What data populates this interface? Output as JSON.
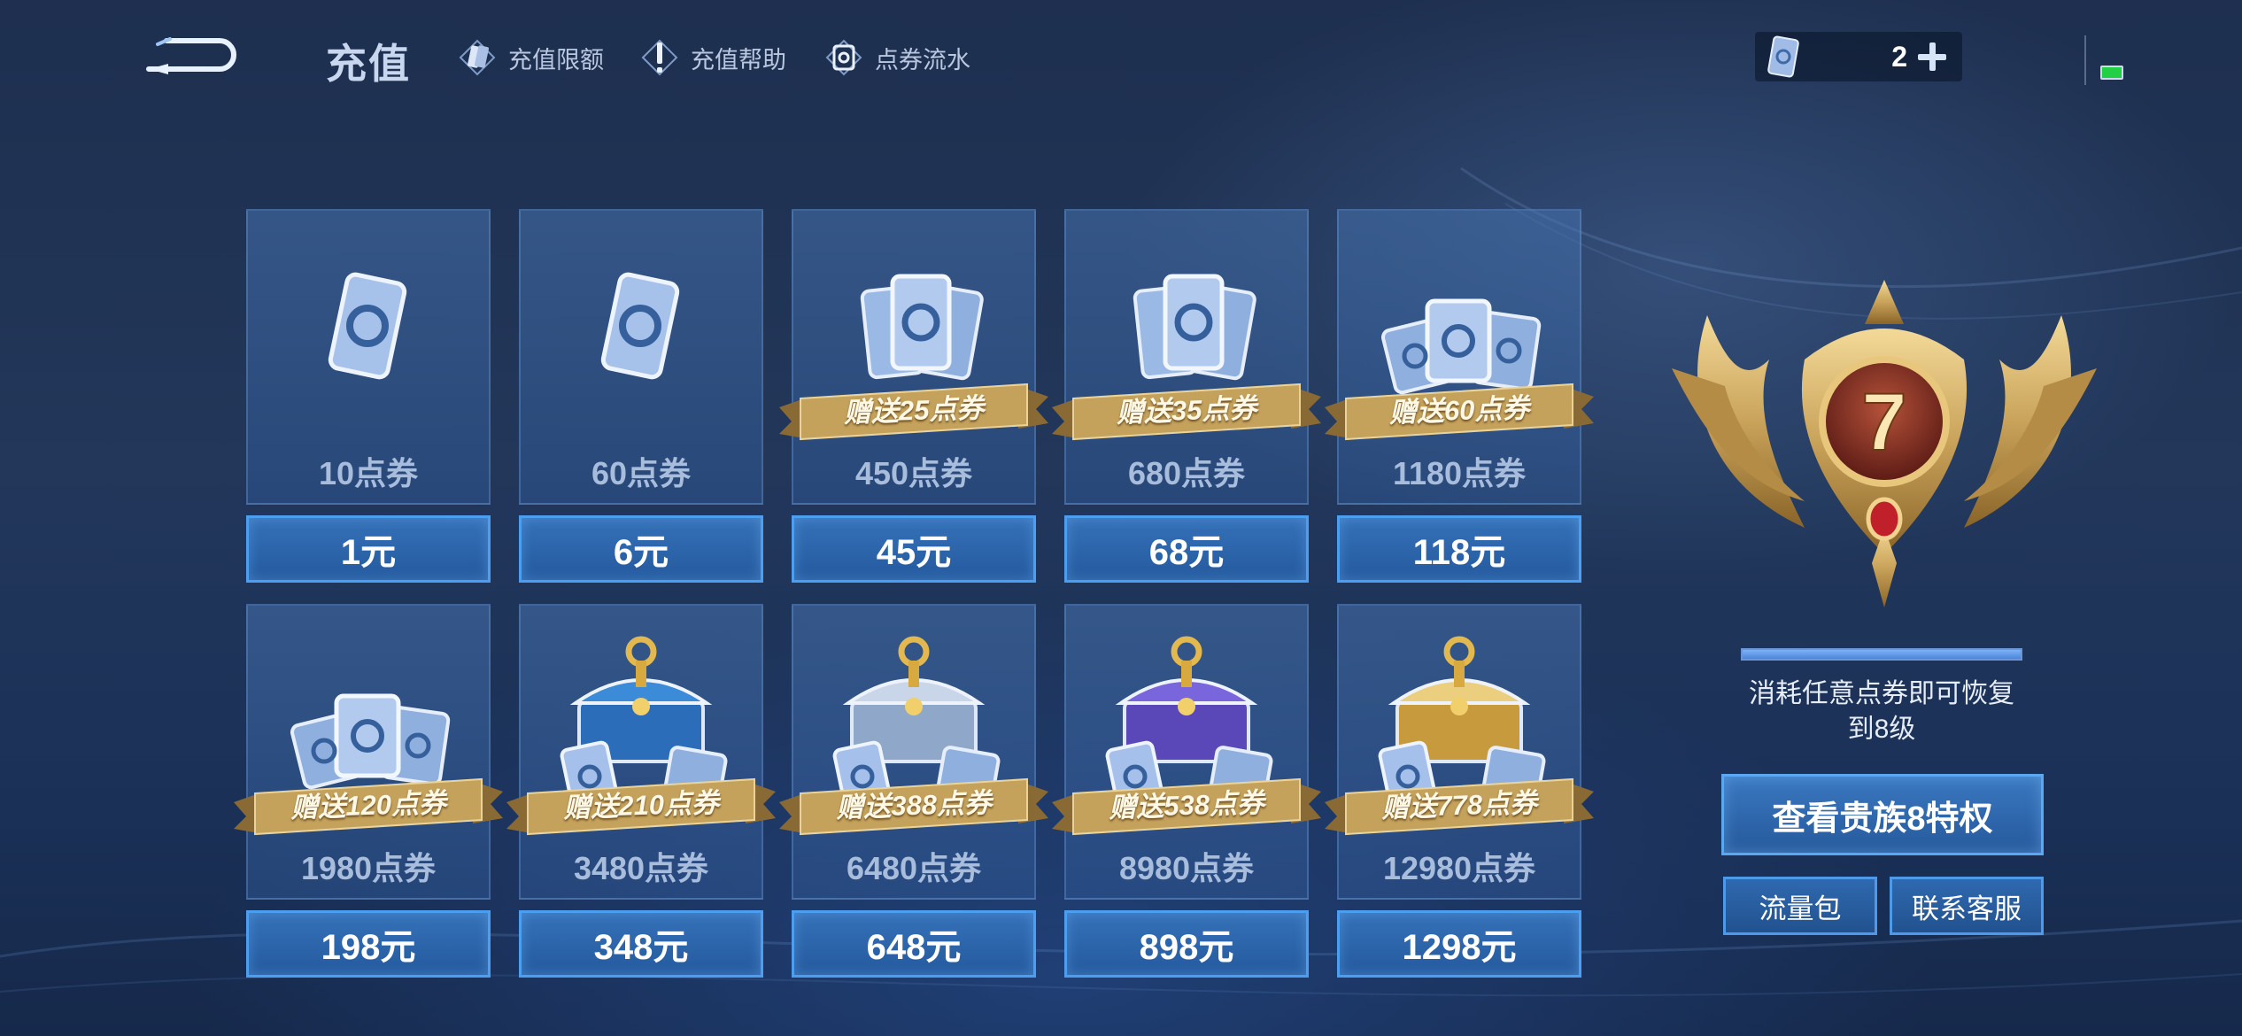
{
  "header": {
    "title": "充值",
    "links": [
      {
        "label": "充值限额",
        "icon": "card-icon"
      },
      {
        "label": "充值帮助",
        "icon": "help-icon"
      },
      {
        "label": "点券流水",
        "icon": "history-icon"
      }
    ]
  },
  "currency": {
    "count": "2",
    "icon": "voucher-icon"
  },
  "products": [
    {
      "amount": "10点券",
      "price": "1元",
      "bonus": "",
      "art": "single-voucher-icon"
    },
    {
      "amount": "60点券",
      "price": "6元",
      "bonus": "",
      "art": "single-voucher-icon"
    },
    {
      "amount": "450点券",
      "price": "45元",
      "bonus": "赠送25点券",
      "art": "voucher-stack-icon"
    },
    {
      "amount": "680点券",
      "price": "68元",
      "bonus": "赠送35点券",
      "art": "voucher-stack-icon"
    },
    {
      "amount": "1180点券",
      "price": "118元",
      "bonus": "赠送60点券",
      "art": "voucher-pile-icon"
    },
    {
      "amount": "1980点券",
      "price": "198元",
      "bonus": "赠送120点券",
      "art": "voucher-pile-icon"
    },
    {
      "amount": "3480点券",
      "price": "348元",
      "bonus": "赠送210点券",
      "art": "blue-chest-icon"
    },
    {
      "amount": "6480点券",
      "price": "648元",
      "bonus": "赠送388点券",
      "art": "silver-chest-icon"
    },
    {
      "amount": "8980点券",
      "price": "898元",
      "bonus": "赠送538点券",
      "art": "purple-chest-icon"
    },
    {
      "amount": "12980点券",
      "price": "1298元",
      "bonus": "赠送778点券",
      "art": "gold-chest-icon"
    }
  ],
  "nobility": {
    "level": "7",
    "progress": 1.0,
    "restore_text_line1": "消耗任意点券即可恢复",
    "restore_text_line2": "到8级",
    "view_button": "查看贵族8特权",
    "data_pack_button": "流量包",
    "support_button": "联系客服"
  },
  "colors": {
    "accent_blue": "#4c9ff0",
    "gold": "#c9a35a",
    "battery_green": "#22d046"
  }
}
